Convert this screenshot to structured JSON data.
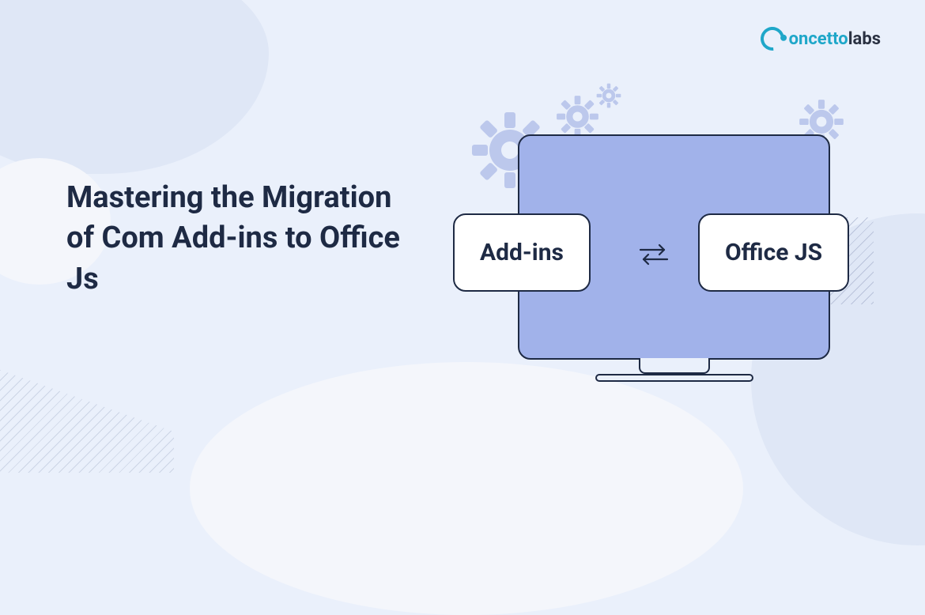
{
  "logo": {
    "oncetto": "oncetto",
    "labs": "labs"
  },
  "title": "Mastering the Migration of Com Add-ins to Office Js",
  "cards": {
    "left": "Add-ins",
    "right": "Office JS"
  },
  "colors": {
    "background": "#eaf0fb",
    "monitor_screen": "#a1b2ea",
    "outline": "#1e2a44",
    "gear": "#bcc8ec",
    "logo_accent": "#1fa7c9"
  },
  "icons": {
    "gear1": "gear-icon",
    "gear2": "gear-icon",
    "gear3": "gear-icon",
    "gear4": "gear-icon",
    "swap": "swap-arrows-icon"
  }
}
